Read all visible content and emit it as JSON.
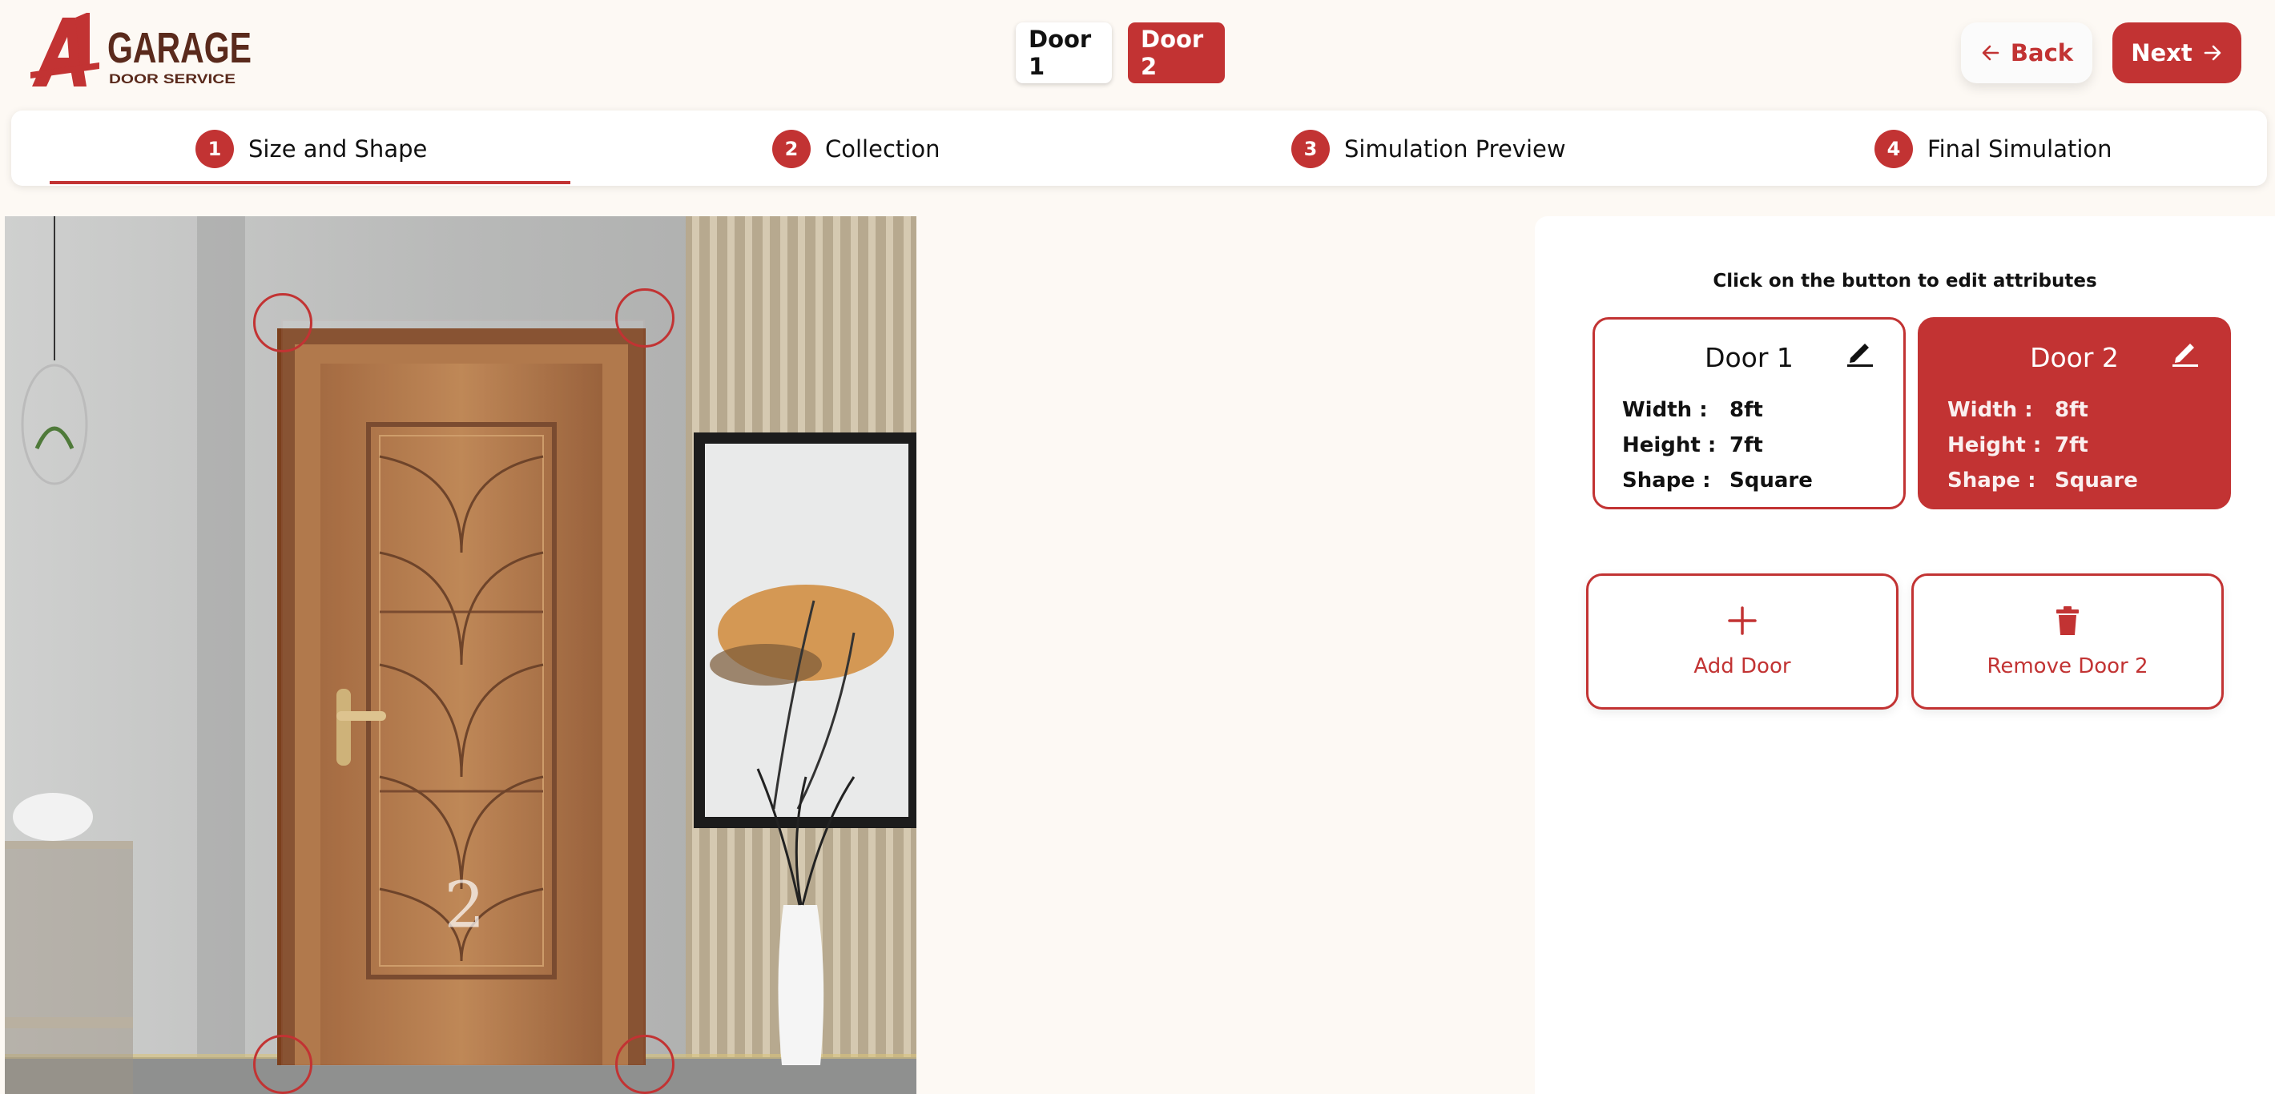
{
  "brand": {
    "name": "A1 GARAGE DOOR SERVICE",
    "logo_icon": "a1-logo-icon",
    "logo_top": "GARAGE",
    "logo_bottom": "DOOR SERVICE"
  },
  "door_tabs": [
    {
      "label": "Door 1",
      "active": false
    },
    {
      "label": "Door 2",
      "active": true
    }
  ],
  "nav": {
    "back_label": "Back",
    "next_label": "Next"
  },
  "steps": [
    {
      "number": "1",
      "label": "Size and Shape"
    },
    {
      "number": "2",
      "label": "Collection"
    },
    {
      "number": "3",
      "label": "Simulation Preview"
    },
    {
      "number": "4",
      "label": "Final Simulation"
    }
  ],
  "canvas": {
    "door_label": "2"
  },
  "panel": {
    "instruction": "Click on the button to edit attributes",
    "doors": [
      {
        "title": "Door 1",
        "width_label": "Width :",
        "width": "8ft",
        "height_label": "Height :",
        "height": "7ft",
        "shape_label": "Shape :",
        "shape": "Square"
      },
      {
        "title": "Door 2",
        "width_label": "Width :",
        "width": "8ft",
        "height_label": "Height :",
        "height": "7ft",
        "shape_label": "Shape :",
        "shape": "Square"
      }
    ],
    "add_door_label": "Add Door",
    "remove_door_label": "Remove Door 2"
  },
  "colors": {
    "accent": "#c23333",
    "background": "#fdf9f4",
    "logo_brown": "#5a2a1c"
  }
}
